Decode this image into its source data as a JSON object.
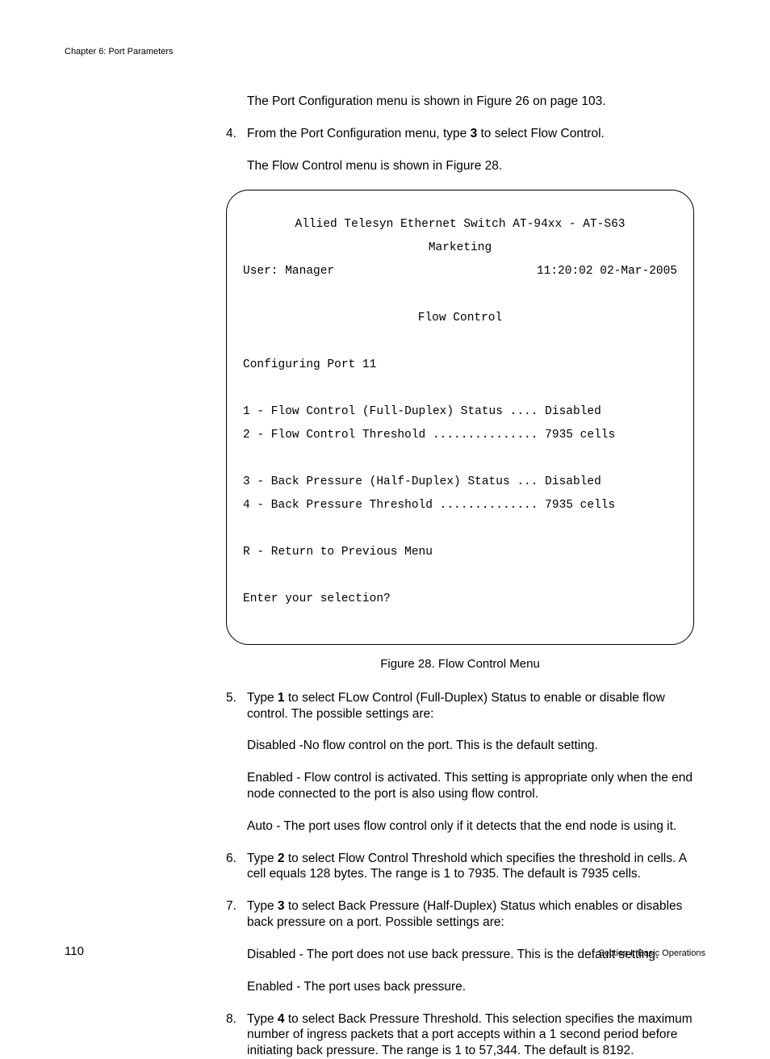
{
  "header": {
    "chapter": "Chapter 6: Port Parameters"
  },
  "intro": {
    "line1": "The Port Configuration menu is shown in Figure 26 on page 103."
  },
  "step4": {
    "num": "4.",
    "text_before": "From the Port Configuration menu, type ",
    "bold": "3",
    "text_after": " to select Flow Control.",
    "sub": "The Flow Control menu is shown in Figure 28."
  },
  "terminal": {
    "title1": "Allied Telesyn Ethernet Switch AT-94xx - AT-S63",
    "title2": "Marketing",
    "user_left": "User: Manager",
    "user_right": "11:20:02 02-Mar-2005",
    "menu_title": "Flow Control",
    "config_line": "Configuring Port 11",
    "opt1": "1 - Flow Control (Full-Duplex) Status .... Disabled",
    "opt2": "2 - Flow Control Threshold ............... 7935 cells",
    "opt3": "3 - Back Pressure (Half-Duplex) Status ... Disabled",
    "opt4": "4 - Back Pressure Threshold .............. 7935 cells",
    "optR": "R - Return to Previous Menu",
    "prompt": "Enter your selection?"
  },
  "figure_caption": "Figure 28. Flow Control Menu",
  "step5": {
    "num": "5.",
    "text_before": "Type ",
    "bold": "1",
    "text_after": " to select FLow Control (Full-Duplex) Status to enable or disable flow control. The possible settings are:",
    "sub1": "Disabled -No flow control on the port. This is the default setting.",
    "sub2": "Enabled - Flow control is activated. This setting is appropriate only when the end node connected to the port is also using flow control.",
    "sub3": "Auto - The port uses flow control only if it detects that the end node is using it."
  },
  "step6": {
    "num": "6.",
    "text_before": "Type ",
    "bold": "2",
    "text_after": " to select Flow Control Threshold which specifies the threshold in cells. A cell equals 128 bytes. The range is 1 to 7935. The default is 7935 cells."
  },
  "step7": {
    "num": "7.",
    "text_before": "Type ",
    "bold": "3",
    "text_after": " to select Back Pressure (Half-Duplex) Status which enables or disables back pressure on a port. Possible settings are:",
    "sub1": "Disabled - The port does not use back pressure. This is the default setting.",
    "sub2": "Enabled - The port uses back pressure."
  },
  "step8": {
    "num": "8.",
    "text_before": "Type ",
    "bold": "4",
    "text_after": " to select Back Pressure Threshold. This selection specifies the maximum number of ingress packets that a port accepts within a 1 second period before initiating back pressure. The range is 1 to 57,344. The default is 8192."
  },
  "footer": {
    "page_number": "110",
    "section": "Section I: Basic Operations"
  }
}
